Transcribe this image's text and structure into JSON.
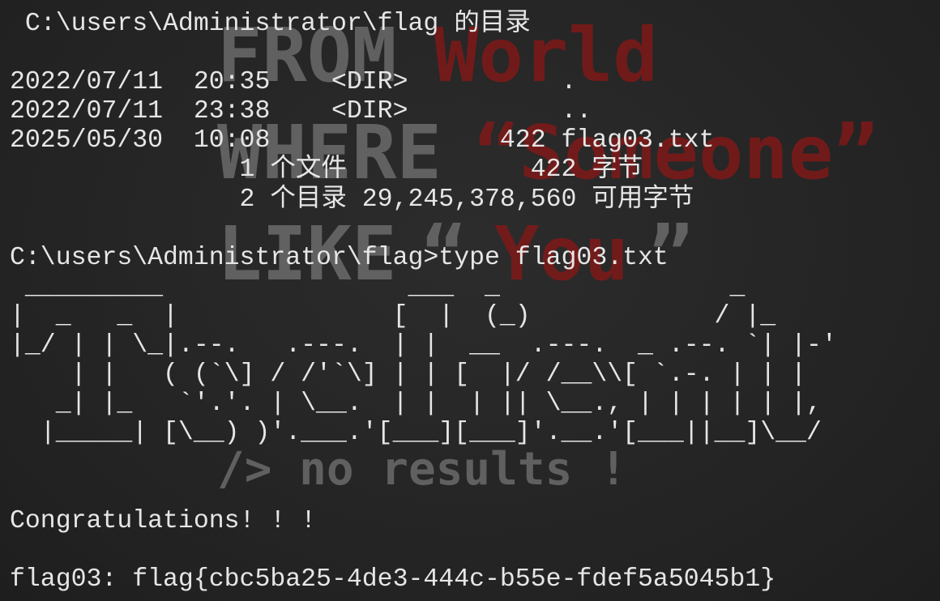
{
  "wallpaper": {
    "line1_a": "FROM",
    "line1_b": "World",
    "line2_a": "WHERE",
    "line2_b": "“Someone”",
    "line3_a": "LIKE",
    "line3_b": "“",
    "line3_c": "You",
    "line3_d": "”",
    "line4": "/> no results !",
    "colors": {
      "gray": "#6b6b6b",
      "red": "#7a1a1a"
    }
  },
  "console": {
    "lines": [
      " C:\\users\\Administrator\\flag 的目录",
      "",
      "2022/07/11  20:35    <DIR>          .",
      "2022/07/11  23:38    <DIR>          ..",
      "2025/05/30  10:08               422 flag03.txt",
      "               1 个文件            422 字节",
      "               2 个目录 29,245,378,560 可用字节",
      "",
      "C:\\users\\Administrator\\flag>type flag03.txt",
      " _________                ___  _               _",
      "|  _   _  |              [  |  (_)            / |_",
      "|_/ | | \\_|.--.   .---.  | |  __  .---.  _ .--. `| |-'",
      "    | |   ( (`\\] / /'`\\] | | [  |/ /__\\\\[ `.-. | | |",
      "   _| |_   `'.'. | \\__.  | |  | || \\__., | | | | | |,",
      "  |_____| [\\__) )'.___.'[___][___]'.__.'[___||__]\\__/",
      "",
      "",
      "Congratulations! ! !",
      "",
      "flag03: flag{cbc5ba25-4de3-444c-b55e-fdef5a5045b1}"
    ]
  }
}
